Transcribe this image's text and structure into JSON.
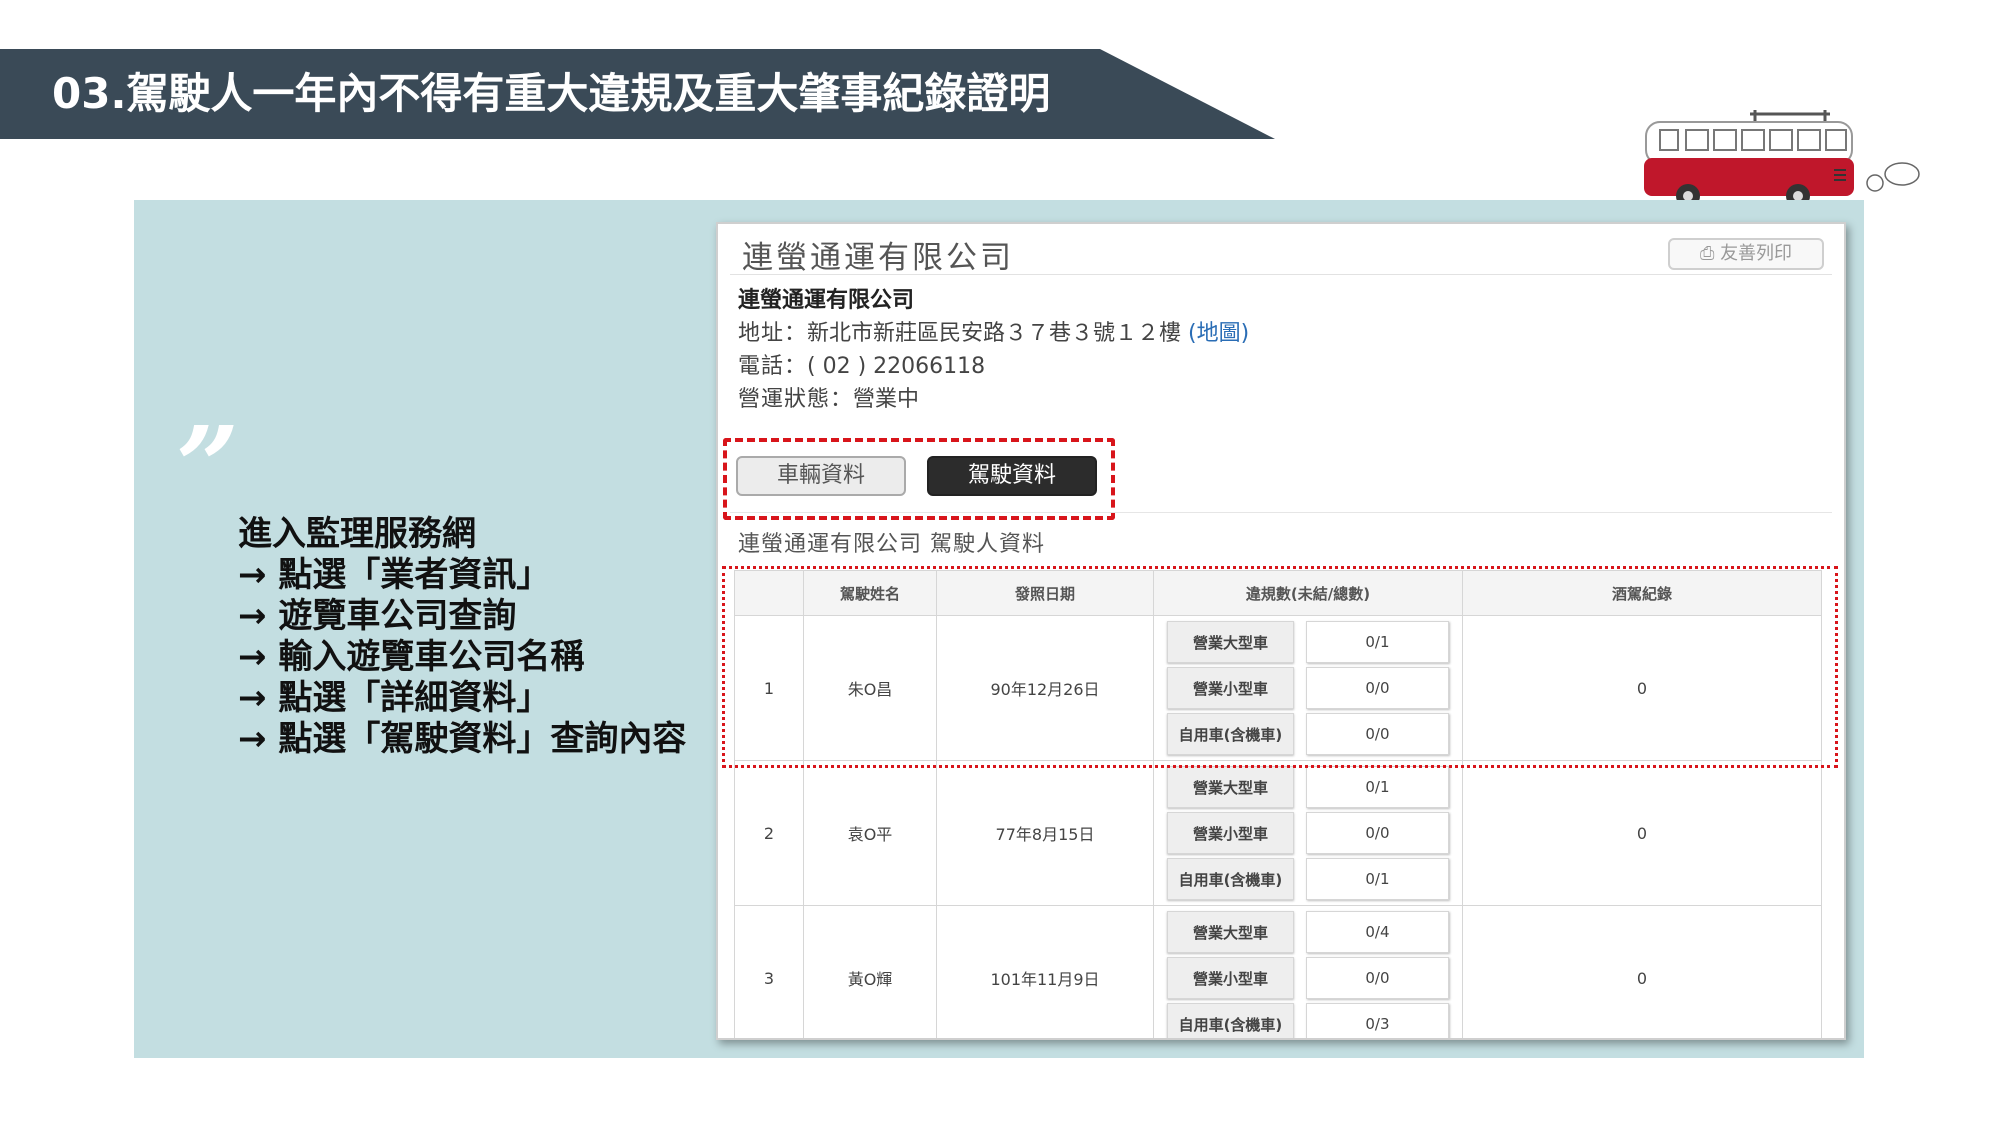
{
  "slide": {
    "title": "03.駕駛人一年內不得有重大違規及重大肇事紀錄證明",
    "quote_mark": "”",
    "steps": [
      "進入監理服務網",
      "→ 點選「業者資訊」",
      "→ 遊覽車公司查詢",
      "→ 輸入遊覽車公司名稱",
      "→ 點選「詳細資料」",
      "→ 點選「駕駛資料」查詢內容"
    ],
    "colors": {
      "banner": "#3a4a57",
      "panel": "#c3dee1",
      "highlight": "#d8151b",
      "bus": "#c0172b"
    }
  },
  "screenshot": {
    "header_title": "連螢通運有限公司",
    "print_label": "友善列印",
    "company_name": "連螢通運有限公司",
    "address_label": "地址：",
    "address_value": "新北市新莊區民安路３７巷３號１２樓",
    "map_link": "(地圖)",
    "phone_label": "電話：",
    "phone_value": "( 02 ) 22066118",
    "status_label": "營運狀態：",
    "status_value": "營業中",
    "tab_vehicle": "車輛資料",
    "tab_driver": "駕駛資料",
    "section_title": "連螢通運有限公司 駕駛人資料",
    "table": {
      "headers": [
        "",
        "駕駛姓名",
        "發照日期",
        "違規數(未結/總數)",
        "酒駕紀錄"
      ],
      "rows": [
        {
          "no": "1",
          "name": "朱O昌",
          "date": "90年12月26日",
          "violations": [
            {
              "type": "營業大型車",
              "value": "0/1"
            },
            {
              "type": "營業小型車",
              "value": "0/0"
            },
            {
              "type": "自用車(含機車)",
              "value": "0/0"
            }
          ],
          "dui": "0"
        },
        {
          "no": "2",
          "name": "袁O平",
          "date": "77年8月15日",
          "violations": [
            {
              "type": "營業大型車",
              "value": "0/1"
            },
            {
              "type": "營業小型車",
              "value": "0/0"
            },
            {
              "type": "自用車(含機車)",
              "value": "0/1"
            }
          ],
          "dui": "0"
        },
        {
          "no": "3",
          "name": "黃O輝",
          "date": "101年11月9日",
          "violations": [
            {
              "type": "營業大型車",
              "value": "0/4"
            },
            {
              "type": "營業小型車",
              "value": "0/0"
            },
            {
              "type": "自用車(含機車)",
              "value": "0/3"
            }
          ],
          "dui": "0"
        }
      ]
    }
  }
}
